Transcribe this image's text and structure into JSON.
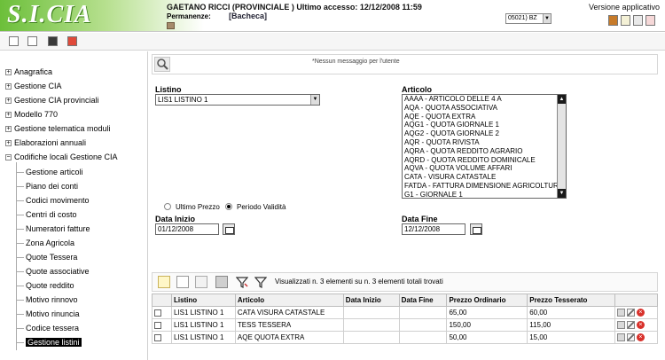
{
  "header": {
    "logo": "S.I.CIA",
    "user_line": "GAETANO RICCI (PROVINCIALE ) Ultimo accesso: 12/12/2008 11:59",
    "permanenze_label": "Permanenze:",
    "permanenze_value": "[Bacheca]",
    "version_label": "Versione applicativo",
    "office_value": "05021) BZ"
  },
  "sidebar": {
    "top_items": [
      "Anagrafica",
      "Gestione CIA",
      "Gestione CIA provinciali",
      "Modello 770",
      "Gestione telematica moduli",
      "Elaborazioni annuali"
    ],
    "open_item": "Codifiche locali Gestione CIA",
    "sub_items": [
      "Gestione articoli",
      "Piano dei conti",
      "Codici movimento",
      "Centri di costo",
      "Numeratori fatture",
      "Zona Agricola",
      "Quote Tessera",
      "Quote associative",
      "Quote reddito",
      "Motivo rinnovo",
      "Motivo rinuncia",
      "Codice tessera",
      "Gestione listini"
    ]
  },
  "message": "*Nessun messaggio per l'utente",
  "form": {
    "listino_label": "Listino",
    "listino_value": "LIS1 LISTINO 1",
    "articolo_label": "Articolo",
    "articolo_options": [
      "AAAA - ARTICOLO DELLE 4 A",
      "AQA - QUOTA ASSOCIATIVA",
      "AQE - QUOTA EXTRA",
      "AQG1 - QUOTA GIORNALE 1",
      "AQG2 - QUOTA GIORNALE 2",
      "AQR - QUOTA RIVISTA",
      "AQRA - QUOTA REDDITO AGRARIO",
      "AQRD - QUOTA REDDITO DOMINICALE",
      "AQVA - QUOTA VOLUME AFFARI",
      "CATA - VISURA CATASTALE",
      "FATDA - FATTURA DIMENSIONE AGRICOLTURA",
      "G1 - GIORNALE 1"
    ],
    "radio_ultimo": "Ultimo Prezzo",
    "radio_periodo": "Periodo Validità",
    "data_inizio_label": "Data Inizio",
    "data_inizio_value": "01/12/2008",
    "data_fine_label": "Data Fine",
    "data_fine_value": "12/12/2008"
  },
  "grid": {
    "info": "Visualizzati n. 3 elementi su n. 3 elementi totali trovati",
    "columns": [
      "Listino",
      "Articolo",
      "Data Inizio",
      "Data Fine",
      "Prezzo Ordinario",
      "Prezzo Tesserato"
    ],
    "rows": [
      [
        "LIS1 LISTINO 1",
        "CATA VISURA CATASTALE",
        "",
        "",
        "65,00",
        "60,00"
      ],
      [
        "LIS1 LISTINO 1",
        "TESS TESSERA",
        "",
        "",
        "150,00",
        "115,00"
      ],
      [
        "LIS1 LISTINO 1",
        "AQE QUOTA EXTRA",
        "",
        "",
        "50,00",
        "15,00"
      ]
    ]
  },
  "colors": {
    "brand_green": "#6cbf3a",
    "delete_red": "#d8312b"
  }
}
